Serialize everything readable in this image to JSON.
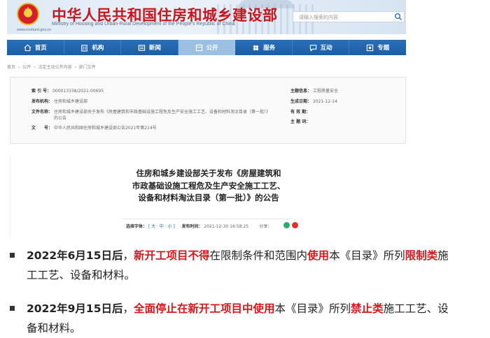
{
  "header": {
    "title": "中华人民共和国住房和城乡建设部",
    "subtitle_en": "Ministry of Housing and Urban-Rural Development of the People's Republic of China",
    "url": "www.mohurd.gov.cn",
    "search_placeholder": "请输入搜索的内容"
  },
  "nav": {
    "items": [
      {
        "label": "首页",
        "icon": "home-icon"
      },
      {
        "label": "机构",
        "icon": "building-icon"
      },
      {
        "label": "新闻",
        "icon": "news-icon"
      },
      {
        "label": "公开",
        "icon": "public-icon"
      },
      {
        "label": "服务",
        "icon": "service-icon"
      },
      {
        "label": "互动",
        "icon": "chat-icon"
      },
      {
        "label": "专题",
        "icon": "topic-icon"
      }
    ],
    "active": "公开"
  },
  "breadcrumb": [
    "首页",
    "›",
    "公开",
    "›",
    "法定主动公开内容",
    "›",
    "部门文件"
  ],
  "info": {
    "index_label": "索 引 号：",
    "index_value": "000013338/2021-00695",
    "theme_label": "主题信息：",
    "theme_value": "工程质量安全",
    "publisher_label": "发布机构：",
    "publisher_value": "住房和城乡建设部",
    "date_label": "生成日期：",
    "date_value": "2021-12-14",
    "docname_label": "文件名称：",
    "docname_value_1": "住房和城乡建设部关于发布《房屋建筑和市政基础设施工程危及生产安全施工工艺、设备和材料淘汰目录（第一批）》",
    "docname_value_2": "的公告",
    "validity_label": "有 效 期：",
    "docnum_label": "文　　号：",
    "docnum_value": "中华人民共和国住房和城乡建设部公告2021年第214号",
    "keywords_label": "主 题 词："
  },
  "article": {
    "title_line1": "住房和城乡建设部关于发布《房屋建筑和",
    "title_line2": "市政基础设施工程危及生产安全施工工艺、",
    "title_line3": "设备和材料淘汰目录（第一批）》的公告",
    "font_label": "选择字体：",
    "font_options": "[ 大 · 中 · 小 ]",
    "publish_label": "发布时间：",
    "publish_value": "2021-12-30 16:58:25",
    "share_label": "分享："
  },
  "bullets": [
    {
      "date": "2022年6月15日后",
      "sep": "，",
      "red1": "新开工项目不得",
      "t1": "在限制条件和范围内",
      "red2": "使用",
      "t2": "本《目录》所列",
      "red3": "限制类",
      "t3": "施",
      "line2": "工工艺、设备和材料。"
    },
    {
      "date": "2022年9月15日后",
      "sep": "，",
      "red1": "全面停止在新开工项目中使用",
      "t1": "本《目录》所列",
      "red2": "禁止类",
      "t2": "施工工艺、设",
      "line2": "备和材料。"
    }
  ],
  "colors": {
    "nav_blue": "#1c5ea5",
    "nav_active": "#9cc0e4",
    "title_red": "#c8161d",
    "highlight_red": "#d9161c"
  }
}
